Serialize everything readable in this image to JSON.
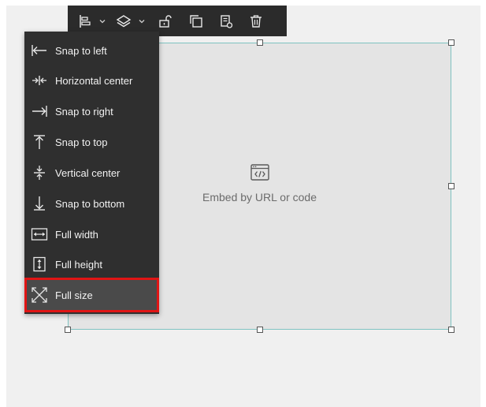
{
  "toolbar": {
    "buttons": [
      {
        "name": "align-icon"
      },
      {
        "name": "chevron-down-icon"
      },
      {
        "name": "layers-icon"
      },
      {
        "name": "chevron-down-icon"
      },
      {
        "name": "unlock-icon"
      },
      {
        "name": "duplicate-icon"
      },
      {
        "name": "settings-document-icon"
      },
      {
        "name": "trash-icon"
      }
    ]
  },
  "align_menu": {
    "items": [
      {
        "label": "Snap to left",
        "icon": "snap-left-icon"
      },
      {
        "label": "Horizontal center",
        "icon": "horizontal-center-icon"
      },
      {
        "label": "Snap to right",
        "icon": "snap-right-icon"
      },
      {
        "label": "Snap to top",
        "icon": "snap-top-icon"
      },
      {
        "label": "Vertical center",
        "icon": "vertical-center-icon"
      },
      {
        "label": "Snap to bottom",
        "icon": "snap-bottom-icon"
      },
      {
        "label": "Full width",
        "icon": "full-width-icon"
      },
      {
        "label": "Full height",
        "icon": "full-height-icon"
      },
      {
        "label": "Full size",
        "icon": "full-size-icon",
        "selected": true
      }
    ]
  },
  "widget": {
    "placeholder_text": "Embed by URL or code",
    "icon": "embed-code-icon"
  },
  "colors": {
    "toolbar_bg": "#2b2b2b",
    "menu_bg": "#2f2f2f",
    "highlight_border": "#e01515",
    "widget_border": "#7fc3c1"
  }
}
